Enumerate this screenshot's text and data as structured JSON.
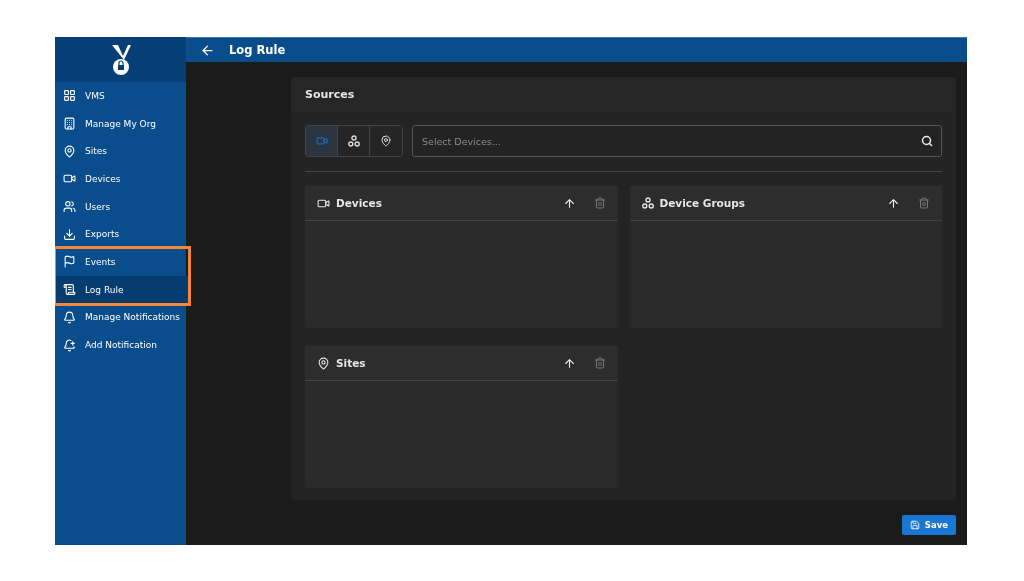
{
  "sidebar": {
    "items": [
      {
        "kind": "grid",
        "label": "VMS",
        "selected": false,
        "highlighted": false
      },
      {
        "kind": "building",
        "label": "Manage My Org",
        "selected": false,
        "highlighted": false
      },
      {
        "kind": "pin",
        "label": "Sites",
        "selected": false,
        "highlighted": false
      },
      {
        "kind": "camera",
        "label": "Devices",
        "selected": false,
        "highlighted": false
      },
      {
        "kind": "users",
        "label": "Users",
        "selected": false,
        "highlighted": false
      },
      {
        "kind": "download",
        "label": "Exports",
        "selected": false,
        "highlighted": false
      },
      {
        "kind": "flag",
        "label": "Events",
        "selected": false,
        "highlighted": true
      },
      {
        "kind": "scroll",
        "label": "Log Rule",
        "selected": true,
        "highlighted": true
      },
      {
        "kind": "bell",
        "label": "Manage Notifications",
        "selected": false,
        "highlighted": false
      },
      {
        "kind": "bellplus",
        "label": "Add Notification",
        "selected": false,
        "highlighted": false
      }
    ]
  },
  "header": {
    "title": "Log Rule"
  },
  "sources": {
    "title": "Sources",
    "source_types": [
      {
        "kind": "camera",
        "selected": true
      },
      {
        "kind": "groups",
        "selected": false
      },
      {
        "kind": "pin",
        "selected": false
      }
    ],
    "search": {
      "placeholder": "Select Devices..."
    },
    "panels": [
      {
        "kind": "camera",
        "title": "Devices"
      },
      {
        "kind": "groups",
        "title": "Device Groups"
      },
      {
        "kind": "pin",
        "title": "Sites"
      }
    ]
  },
  "save_button": {
    "label": "Save"
  }
}
